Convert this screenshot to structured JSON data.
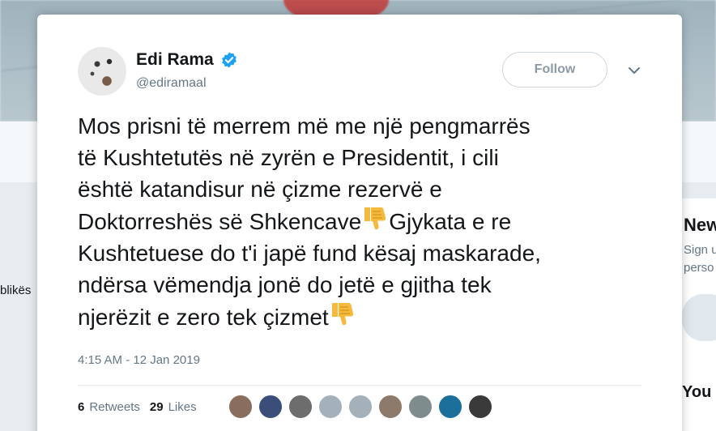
{
  "background": {
    "left_text": "blikës",
    "right_title": "New",
    "right_line1": "Sign u",
    "right_line2": "perso",
    "right_title2": "You"
  },
  "tweet": {
    "author_name": "Edi Rama",
    "author_handle": "@ediramaal",
    "follow_label": "Follow",
    "text_lines": [
      "Mos prisni të merrem më me një pengmarrës",
      "të Kushtetutës në zyrën e Presidentit, i cili",
      "është katandisur në çizme rezervë e",
      "Doktorreshës së Shkencave",
      "Gjykata e re",
      "Kushtetuese do t'i japë fund kësaj maskarade,",
      "ndërsa vëmendja jonë do jetë e gjitha tek",
      "njerëzit e zero tek çizmet"
    ],
    "timestamp": "4:15 AM - 12 Jan 2019",
    "retweets_count": "6",
    "retweets_label": "Retweets",
    "likes_count": "29",
    "likes_label": "Likes"
  },
  "icons": {
    "verified": "verified-badge-icon",
    "more": "chevron-down-icon",
    "emoji": "thumbs-down-emoji-icon"
  },
  "colors": {
    "accent": "#1da1f2",
    "text": "#14171a",
    "muted": "#657786",
    "emoji": "#f5b93b"
  },
  "likers": [
    {
      "color": "#8a6e5d"
    },
    {
      "color": "#3b4e7a"
    },
    {
      "color": "#6d6d6d"
    },
    {
      "color": "#a4b0ba"
    },
    {
      "color": "#a4b0ba"
    },
    {
      "color": "#8e7a6b"
    },
    {
      "color": "#7f8c8d"
    },
    {
      "color": "#1c6f9a"
    },
    {
      "color": "#3a3a3a"
    }
  ]
}
